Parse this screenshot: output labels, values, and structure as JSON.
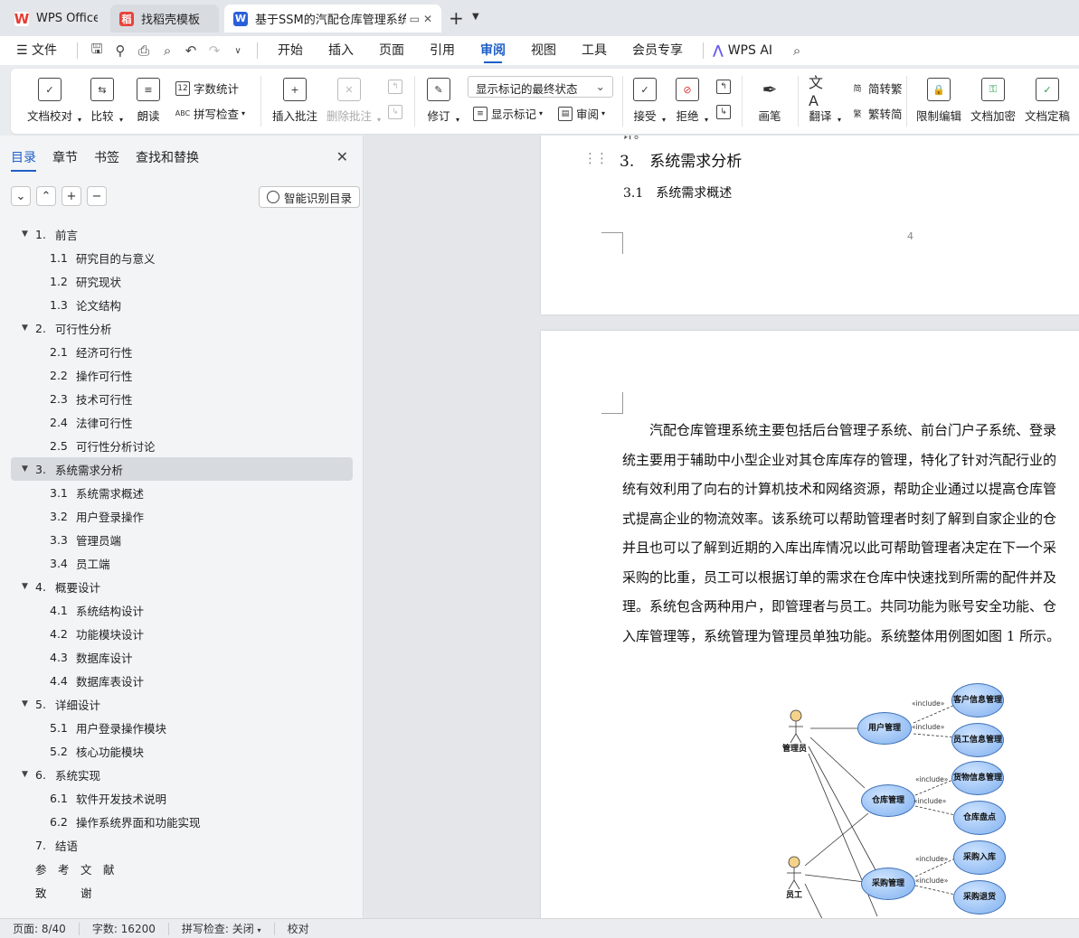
{
  "tabs": [
    {
      "title": "WPS Office",
      "icon": "wps-logo-icon",
      "color": "#e83a2f"
    },
    {
      "title": "找稻壳模板",
      "icon": "docer-icon",
      "color": "#e8433c"
    },
    {
      "title": "基于SSM的汽配仓库管理系统",
      "icon": "writer-doc-icon",
      "color": "#2b5fd9"
    }
  ],
  "menubar": {
    "file": "文件",
    "items": [
      "开始",
      "插入",
      "页面",
      "引用",
      "审阅",
      "视图",
      "工具",
      "会员专享"
    ],
    "active": "审阅",
    "ai": "WPS AI"
  },
  "ribbon": {
    "doc_check": "文档校对",
    "compare": "比较",
    "read_aloud": "朗读",
    "word_count": "字数统计",
    "spell_check": "拼写检查",
    "insert_comment": "插入批注",
    "delete_comment": "删除批注",
    "track_changes": "修订",
    "markup_select": "显示标记的最终状态",
    "show_markup": "显示标记",
    "review_pane": "审阅",
    "accept": "接受",
    "reject": "拒绝",
    "pen": "画笔",
    "translate": "翻译",
    "to_traditional": "简转繁",
    "to_simplified": "繁转简",
    "restrict_edit": "限制编辑",
    "encrypt": "文档加密",
    "finalize": "文档定稿"
  },
  "nav": {
    "tabs": [
      "目录",
      "章节",
      "书签",
      "查找和替换"
    ],
    "active_tab": "目录",
    "smart_toc": "智能识别目录",
    "toc": [
      {
        "level": 1,
        "num": "1.",
        "text": "前言",
        "arrow": true
      },
      {
        "level": 2,
        "num": "1.1",
        "text": "研究目的与意义"
      },
      {
        "level": 2,
        "num": "1.2",
        "text": "研究现状"
      },
      {
        "level": 2,
        "num": "1.3",
        "text": "论文结构"
      },
      {
        "level": 1,
        "num": "2.",
        "text": "可行性分析",
        "arrow": true
      },
      {
        "level": 2,
        "num": "2.1",
        "text": "经济可行性"
      },
      {
        "level": 2,
        "num": "2.2",
        "text": "操作可行性"
      },
      {
        "level": 2,
        "num": "2.3",
        "text": "技术可行性"
      },
      {
        "level": 2,
        "num": "2.4",
        "text": "法律可行性"
      },
      {
        "level": 2,
        "num": "2.5",
        "text": "可行性分析讨论"
      },
      {
        "level": 1,
        "num": "3.",
        "text": "系统需求分析",
        "arrow": true,
        "selected": true
      },
      {
        "level": 2,
        "num": "3.1",
        "text": "系统需求概述"
      },
      {
        "level": 2,
        "num": "3.2",
        "text": "用户登录操作"
      },
      {
        "level": 2,
        "num": "3.3",
        "text": "管理员端"
      },
      {
        "level": 2,
        "num": "3.4",
        "text": "员工端"
      },
      {
        "level": 1,
        "num": "4.",
        "text": "概要设计",
        "arrow": true
      },
      {
        "level": 2,
        "num": "4.1",
        "text": "系统结构设计"
      },
      {
        "level": 2,
        "num": "4.2",
        "text": "功能模块设计"
      },
      {
        "level": 2,
        "num": "4.3",
        "text": "数据库设计"
      },
      {
        "level": 2,
        "num": "4.4",
        "text": "数据库表设计"
      },
      {
        "level": 1,
        "num": "5.",
        "text": "详细设计",
        "arrow": true
      },
      {
        "level": 2,
        "num": "5.1",
        "text": "用户登录操作模块"
      },
      {
        "level": 2,
        "num": "5.2",
        "text": "核心功能模块"
      },
      {
        "level": 1,
        "num": "6.",
        "text": "系统实现",
        "arrow": true
      },
      {
        "level": 2,
        "num": "6.1",
        "text": "软件开发技术说明"
      },
      {
        "level": 2,
        "num": "6.2",
        "text": "操作系统界面和功能实现"
      },
      {
        "level": 1,
        "num": "7.",
        "text": "结语"
      },
      {
        "level": 1,
        "num": "",
        "text": "参　考　文　献"
      },
      {
        "level": 1,
        "num": "",
        "text": "致　　　谢"
      }
    ]
  },
  "document": {
    "partial_top": "计。",
    "heading": "3.　系统需求分析",
    "subheading": "3.1　系统需求概述",
    "page_number": "4",
    "paragraph_lines": [
      "　　汽配仓库管理系统主要包括后台管理子系统、前台门户子系统、登录",
      "统主要用于辅助中小型企业对其仓库库存的管理，特化了针对汽配行业的",
      "统有效利用了向右的计算机技术和网络资源，帮助企业通过以提高仓库管",
      "式提高企业的物流效率。该系统可以帮助管理者时刻了解到自家企业的仓",
      "并且也可以了解到近期的入库出库情况以此可帮助管理者决定在下一个采",
      "采购的比重，员工可以根据订单的需求在仓库中快速找到所需的配件并及",
      "理。系统包含两种用户，即管理者与员工。共同功能为账号安全功能、仓",
      "入库管理等，系统管理为管理员单独功能。系统整体用例图如图 1 所示。"
    ],
    "diagram": {
      "actors": [
        "管理员",
        "员工"
      ],
      "usecases": [
        "用户管理",
        "客户信息管理",
        "员工信息管理",
        "仓库管理",
        "货物信息管理",
        "仓库盘点",
        "采购管理",
        "采购入库",
        "采购退货"
      ],
      "include_label": "«include»"
    }
  },
  "status": {
    "page": "页面: 8/40",
    "words": "字数: 16200",
    "spell": "拼写检查: 关闭",
    "proof": "校对"
  }
}
